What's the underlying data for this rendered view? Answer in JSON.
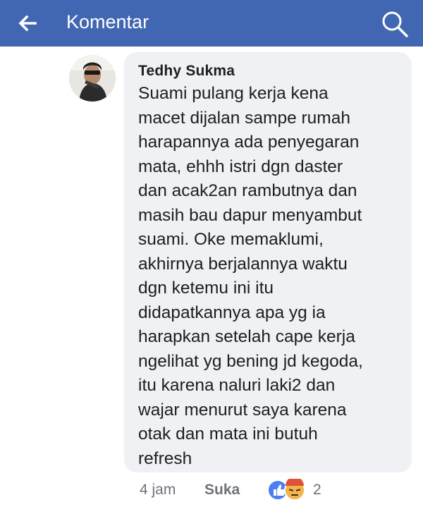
{
  "header": {
    "title": "Komentar",
    "back_icon": "arrow-left-icon",
    "search_icon": "search-icon",
    "bg_color": "#4267b2"
  },
  "comment": {
    "author": "Tedhy Sukma",
    "text": "Suami pulang kerja kena\nmacet dijalan sampe rumah\nharapannya ada penyegaran\nmata, ehhh istri dgn daster\ndan acak2an rambutnya dan\nmasih bau dapur menyambut\nsuami. Oke memaklumi,\nakhirnya berjalannya waktu\ndgn ketemu ini itu\ndidapatkannya apa yg ia\nharapkan setelah cape kerja\nngelihat yg bening jd kegoda,\nitu karena naluri laki2 dan\nwajar menurut saya karena\notak dan mata ini butuh\nrefresh",
    "time": "4 jam",
    "like_label": "Suka",
    "reaction_count": "2",
    "reaction_icons": [
      "like-reaction-icon",
      "angry-reaction-icon"
    ]
  }
}
